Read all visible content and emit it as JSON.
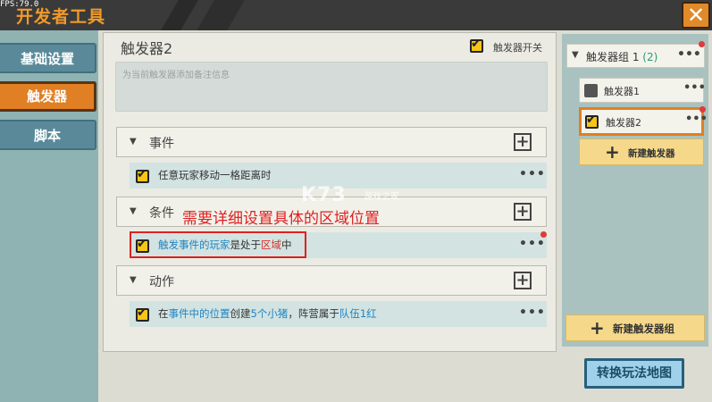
{
  "fps": "FPS:79.0",
  "app_title": "开发者工具",
  "close_glyph": "✕",
  "sidebar": {
    "items": [
      {
        "label": "基础设置",
        "active": false
      },
      {
        "label": "触发器",
        "active": true
      },
      {
        "label": "脚本",
        "active": false
      }
    ]
  },
  "trigger": {
    "name": "触发器2",
    "toggle_label": "触发器开关",
    "toggle_checked": true,
    "note_placeholder": "为当前触发器添加备注信息"
  },
  "sections": {
    "event": {
      "title": "事件",
      "row": {
        "text": "任意玩家移动一格距离时"
      }
    },
    "condition": {
      "title": "条件",
      "row": {
        "p1": "触发事件的玩家",
        "p2": "是处于",
        "p3": "区域",
        "p4": "中"
      }
    },
    "action": {
      "title": "动作",
      "row": {
        "p1": "在",
        "p2": "事件中的位置",
        "p3": "创建",
        "p4": "5个",
        "p5": "小猪",
        "p6": "，阵营属于",
        "p7": "队伍1红"
      }
    }
  },
  "annotation": "需要详细设置具体的区域位置",
  "watermark": {
    "main": "K73",
    "sub": "游戏之家"
  },
  "group": {
    "name": "触发器组 1",
    "count": "(2)",
    "items": [
      {
        "label": "触发器1",
        "checked": false,
        "selected": false
      },
      {
        "label": "触发器2",
        "checked": true,
        "selected": true
      }
    ],
    "new_trigger": "新建触发器",
    "new_group": "新建触发器组"
  },
  "plus_glyph": "+",
  "more_glyph": "•••",
  "switch_map": "转换玩法地图",
  "colors": {
    "accent": "#e07f23",
    "annotation": "#e02020",
    "link_blue": "#1f84c2"
  }
}
